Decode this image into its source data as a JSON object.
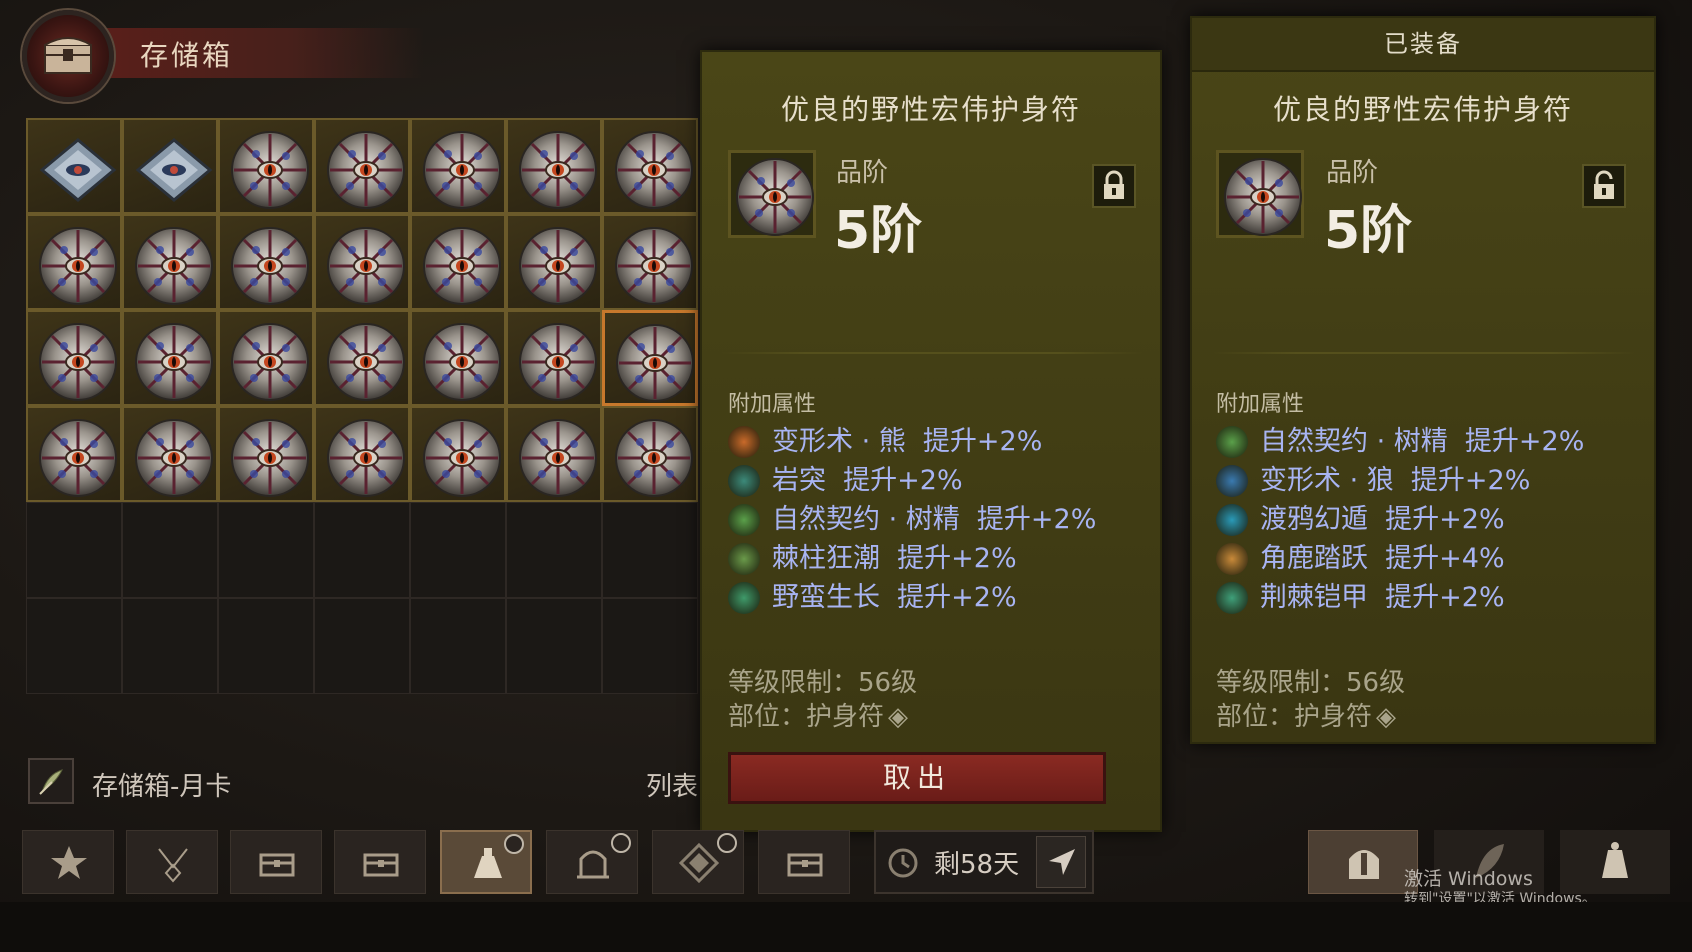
{
  "header": {
    "title": "存储箱"
  },
  "storage": {
    "label": "存储箱-月卡",
    "list_label": "列表"
  },
  "tooltip_left": {
    "item_name": "优良的野性宏伟护身符",
    "tier_label": "品阶",
    "tier_value": "5阶",
    "lock_state": "locked",
    "affix_title": "附加属性",
    "affixes": [
      {
        "name": "变形术 · 熊",
        "value": "提升+2%",
        "icon": "bear-claw-icon",
        "color": "#c96a2a"
      },
      {
        "name": "岩突",
        "value": "提升+2%",
        "icon": "earth-spike-icon",
        "color": "#3c8a7a"
      },
      {
        "name": "自然契约 · 树精",
        "value": "提升+2%",
        "icon": "nature-pact-icon",
        "color": "#5aa04a"
      },
      {
        "name": "棘柱狂潮",
        "value": "提升+2%",
        "icon": "thorn-surge-icon",
        "color": "#6a9a4a"
      },
      {
        "name": "野蛮生长",
        "value": "提升+2%",
        "icon": "wild-growth-icon",
        "color": "#3f9a6a"
      }
    ],
    "level_req": "等级限制：56级",
    "slot": "部位：护身符",
    "take_button": "取出"
  },
  "tooltip_right": {
    "equipped_label": "已装备",
    "item_name": "优良的野性宏伟护身符",
    "tier_label": "品阶",
    "tier_value": "5阶",
    "lock_state": "unlocked",
    "affix_title": "附加属性",
    "affixes": [
      {
        "name": "自然契约 · 树精",
        "value": "提升+2%",
        "icon": "nature-pact-icon",
        "color": "#5aa04a"
      },
      {
        "name": "变形术 · 狼",
        "value": "提升+2%",
        "icon": "wolf-form-icon",
        "color": "#3a7ab0"
      },
      {
        "name": "渡鸦幻遁",
        "value": "提升+2%",
        "icon": "raven-icon",
        "color": "#2a9ab8"
      },
      {
        "name": "角鹿踏跃",
        "value": "提升+4%",
        "icon": "stag-leap-icon",
        "color": "#c98a3a"
      },
      {
        "name": "荆棘铠甲",
        "value": "提升+2%",
        "icon": "thorn-armor-icon",
        "color": "#3fa07a"
      }
    ],
    "level_req": "等级限制：56级",
    "slot": "部位：护身符"
  },
  "toolbar": {
    "timer_text": "剩58天",
    "tabs": [
      "favorites",
      "necklace",
      "storage-1",
      "storage-2",
      "potion",
      "shrine",
      "compass",
      "storage-3"
    ]
  },
  "watermark": {
    "line1": "激活 Windows",
    "line2": "转到\"设置\"以激活 Windows。"
  },
  "colors": {
    "panel_bg": "#433f15",
    "affix_text": "#a8b4f2",
    "take_button": "#7a2420",
    "selected_cell": "#c7782c"
  }
}
